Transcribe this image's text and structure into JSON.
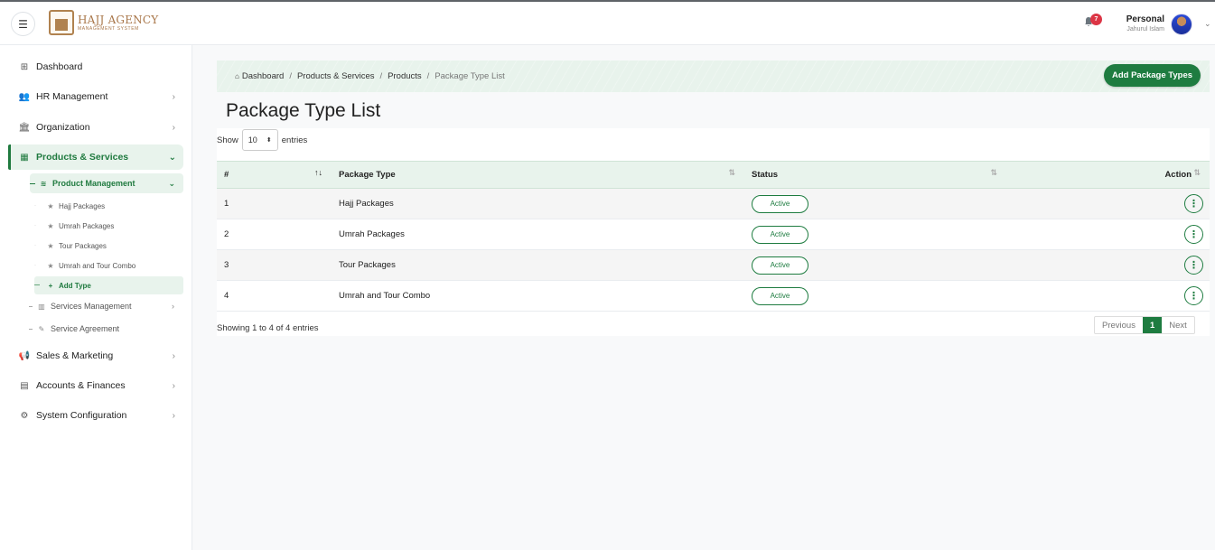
{
  "header": {
    "logo_name": "HAJJ AGENCY",
    "logo_sub": "MANAGEMENT SYSTEM",
    "notification_count": "7",
    "user_role": "Personal",
    "user_name": "Jahurul Islam"
  },
  "sidebar": {
    "dashboard": "Dashboard",
    "hr": "HR Management",
    "organization": "Organization",
    "products": "Products & Services",
    "product_management": "Product Management",
    "leaves": [
      "Hajj Packages",
      "Umrah Packages",
      "Tour Packages",
      "Umrah and Tour Combo"
    ],
    "add_type": "Add Type",
    "services_management": "Services Management",
    "service_agreement": "Service Agreement",
    "sales": "Sales & Marketing",
    "accounts": "Accounts & Finances",
    "system": "System Configuration"
  },
  "breadcrumb": {
    "home": "Dashboard",
    "products_services": "Products & Services",
    "products": "Products",
    "current": "Package Type List"
  },
  "add_button": "Add Package Types",
  "page_title": "Package Type List",
  "length": {
    "show": "Show",
    "value": "10",
    "entries": "entries"
  },
  "table": {
    "headers": {
      "num": "#",
      "type": "Package Type",
      "status": "Status",
      "action": "Action"
    },
    "rows": [
      {
        "num": "1",
        "type": "Hajj Packages",
        "status": "Active"
      },
      {
        "num": "2",
        "type": "Umrah Packages",
        "status": "Active"
      },
      {
        "num": "3",
        "type": "Tour Packages",
        "status": "Active"
      },
      {
        "num": "4",
        "type": "Umrah and Tour Combo",
        "status": "Active"
      }
    ]
  },
  "info": "Showing 1 to 4 of 4 entries",
  "pager": {
    "prev": "Previous",
    "current": "1",
    "next": "Next"
  },
  "colors": {
    "accent": "#1e7c40",
    "accent_light": "#e8f3ec",
    "badge": "#dc3545"
  }
}
